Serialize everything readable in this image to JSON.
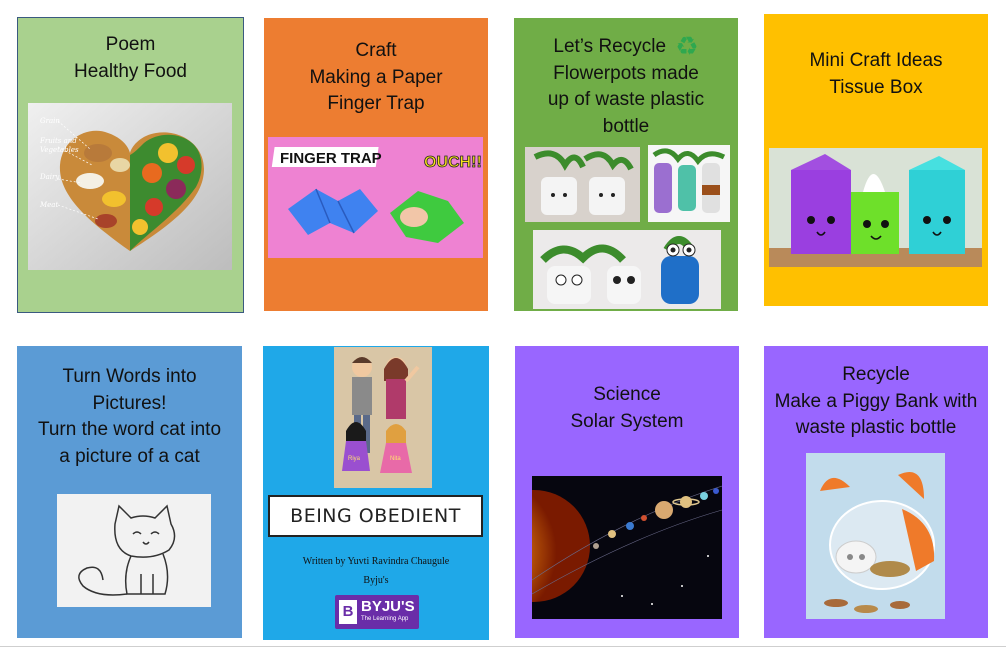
{
  "cards": [
    {
      "lines": [
        "Poem",
        "Healthy Food"
      ],
      "food_labels": [
        "Grain",
        "Fruits and",
        "Vegetables",
        "Dairy",
        "Meat"
      ],
      "color": "#a9d18e"
    },
    {
      "lines": [
        "Craft",
        "Making a Paper",
        "Finger Trap"
      ],
      "banner_text": "FINGER TRAP",
      "exclaim_text": "OUCH!!",
      "color": "#ed7d31"
    },
    {
      "lines": [
        "Let’s Recycle",
        "Flowerpots made",
        "up of waste plastic",
        "bottle"
      ],
      "recycle_symbol": "♻",
      "color": "#70ad47"
    },
    {
      "lines": [
        "Mini Craft Ideas",
        "Tissue Box"
      ],
      "color": "#ffc000"
    },
    {
      "lines": [
        "Turn Words into",
        "Pictures!",
        "Turn the word cat into",
        "a picture of a cat"
      ],
      "color": "#5b9bd5"
    },
    {
      "title": "BEING OBEDIENT",
      "author": "Written by Yuvti Ravindra Chaugule",
      "publisher": "Byju's",
      "logo_text": "BYJU'S",
      "logo_tagline": "The Learning App",
      "char_names": [
        "Riya",
        "Nita"
      ],
      "color": "#1fa8e8"
    },
    {
      "lines": [
        "Science",
        "Solar System"
      ],
      "color": "#9966ff"
    },
    {
      "lines": [
        "Recycle",
        "Make a Piggy Bank with",
        "waste plastic bottle"
      ],
      "color": "#9966ff"
    }
  ]
}
